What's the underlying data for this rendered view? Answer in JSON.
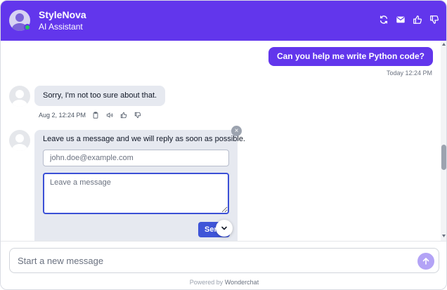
{
  "header": {
    "title": "StyleNova",
    "subtitle": "AI Assistant",
    "background": "#6236ec",
    "online_color": "#22c55e",
    "icons": [
      "refresh-icon",
      "mail-icon",
      "thumbs-up-icon",
      "thumbs-down-icon"
    ]
  },
  "messages": {
    "user": {
      "text": "Can you help me write Python code?",
      "time": "Today 12:24 PM"
    },
    "bot": {
      "text": "Sorry, I'm not too sure about that.",
      "time": "Aug 2, 12:24 PM",
      "actions": [
        "copy-icon",
        "speaker-icon",
        "thumbs-up-icon",
        "thumbs-down-icon"
      ]
    },
    "contact_form": {
      "title": "Leave us a message and we will reply as soon as possible.",
      "email_placeholder": "john.doe@example.com",
      "message_placeholder": "Leave a message",
      "send_label": "Send",
      "close_glyph": "×"
    }
  },
  "composer": {
    "placeholder": "Start a new message"
  },
  "footer": {
    "powered_prefix": "Powered by",
    "brand": "Wonderchat"
  },
  "colors": {
    "accent": "#6236ec",
    "send_button": "#3f55d8",
    "send_circle": "#b3a3f6",
    "bot_bubble": "#e6e9f0"
  }
}
